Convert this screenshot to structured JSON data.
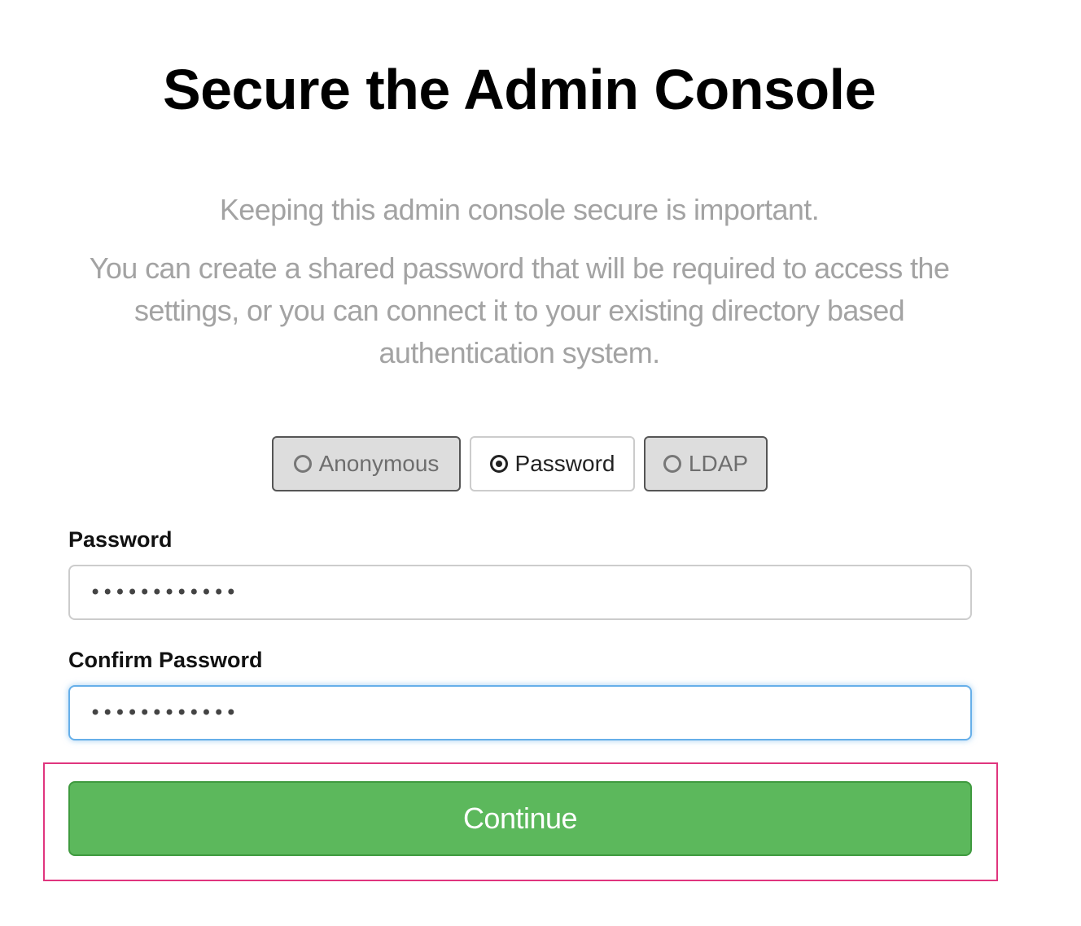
{
  "page": {
    "title": "Secure the Admin Console",
    "intro_line1": "Keeping this admin console secure is important.",
    "intro_line2": "You can create a shared password that will be required to access the settings, or you can connect it to your existing directory based authentication system."
  },
  "auth_options": {
    "anonymous": "Anonymous",
    "password": "Password",
    "ldap": "LDAP",
    "selected": "Password"
  },
  "form": {
    "password_label": "Password",
    "password_value": "••••••••••••",
    "confirm_label": "Confirm Password",
    "confirm_value": "••••••••••••",
    "continue_label": "Continue"
  },
  "colors": {
    "primary_button": "#5cb85c",
    "focus_border": "#66afe9",
    "highlight": "#e0357e",
    "muted_text": "#a3a3a3"
  }
}
